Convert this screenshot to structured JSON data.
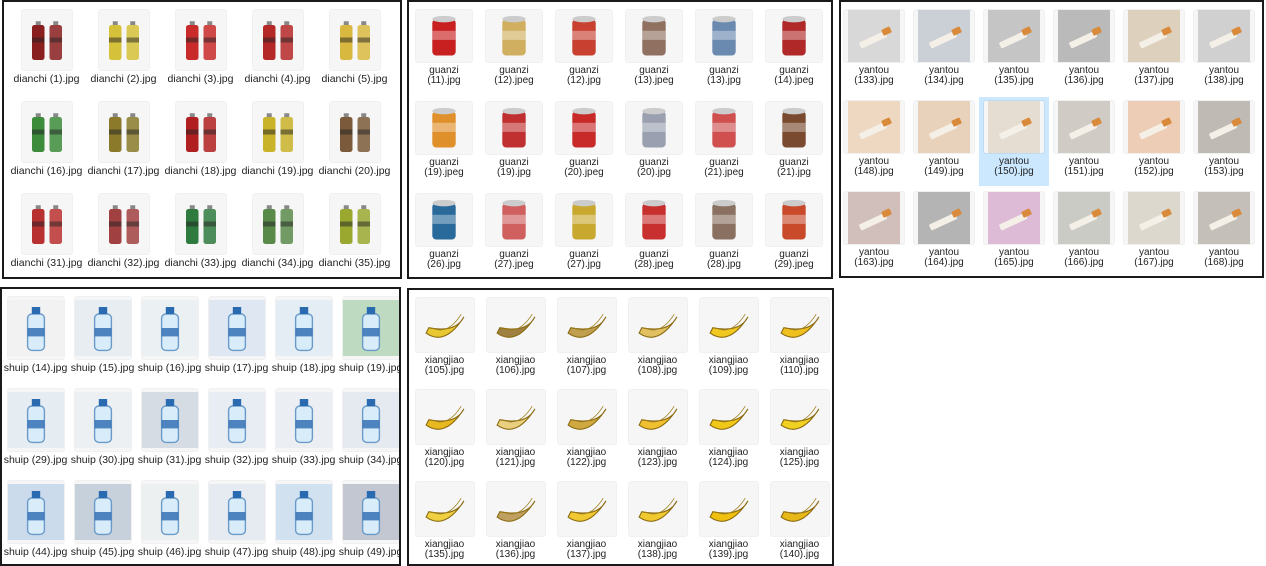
{
  "panels": [
    {
      "id": "dianchi",
      "items": [
        {
          "name": "dianchi (1).jpg",
          "c": "#8a1f1f",
          "icon": "battery-icon"
        },
        {
          "name": "dianchi (2).jpg",
          "c": "#d6c13a",
          "icon": "battery-icon"
        },
        {
          "name": "dianchi (3).jpg",
          "c": "#c92a2a",
          "icon": "battery-icon"
        },
        {
          "name": "dianchi (4).jpg",
          "c": "#b52828",
          "icon": "battery-icon"
        },
        {
          "name": "dianchi (5).jpg",
          "c": "#d9b840",
          "icon": "battery-icon"
        },
        {
          "name": "dianchi (16).jpg",
          "c": "#3c8c3c",
          "icon": "battery-icon"
        },
        {
          "name": "dianchi (17).jpg",
          "c": "#8a7a2a",
          "icon": "battery-icon"
        },
        {
          "name": "dianchi (18).jpg",
          "c": "#b02020",
          "icon": "battery-icon"
        },
        {
          "name": "dianchi (19).jpg",
          "c": "#c9b32a",
          "icon": "battery-icon"
        },
        {
          "name": "dianchi (20).jpg",
          "c": "#7a5a3a",
          "icon": "battery-icon"
        },
        {
          "name": "dianchi (31).jpg",
          "c": "#b83030",
          "icon": "battery-icon"
        },
        {
          "name": "dianchi (32).jpg",
          "c": "#a04040",
          "icon": "battery-icon"
        },
        {
          "name": "dianchi (33).jpg",
          "c": "#2f7a3f",
          "icon": "battery-icon"
        },
        {
          "name": "dianchi (34).jpg",
          "c": "#5a8a4a",
          "icon": "battery-icon"
        },
        {
          "name": "dianchi (35).jpg",
          "c": "#9aa830",
          "icon": "battery-icon"
        }
      ]
    },
    {
      "id": "guanzi",
      "items": [
        {
          "name": "guanzi (11).jpg",
          "c": "#c82020",
          "icon": "can-icon"
        },
        {
          "name": "guanzi (12).jpeg",
          "c": "#d0b060",
          "icon": "can-icon"
        },
        {
          "name": "guanzi (12).jpg",
          "c": "#c84030",
          "icon": "can-icon"
        },
        {
          "name": "guanzi (13).jpeg",
          "c": "#907060",
          "icon": "can-icon"
        },
        {
          "name": "guanzi (13).jpg",
          "c": "#6a8ab0",
          "icon": "can-icon"
        },
        {
          "name": "guanzi (14).jpeg",
          "c": "#b02828",
          "icon": "can-icon"
        },
        {
          "name": "guanzi (19).jpeg",
          "c": "#e0902a",
          "icon": "can-icon"
        },
        {
          "name": "guanzi (19).jpg",
          "c": "#c03030",
          "icon": "can-icon"
        },
        {
          "name": "guanzi (20).jpeg",
          "c": "#c82a2a",
          "icon": "can-icon"
        },
        {
          "name": "guanzi (20).jpg",
          "c": "#9aa0b0",
          "icon": "can-icon"
        },
        {
          "name": "guanzi (21).jpeg",
          "c": "#d05050",
          "icon": "can-icon"
        },
        {
          "name": "guanzi (21).jpg",
          "c": "#7a4a30",
          "icon": "can-icon"
        },
        {
          "name": "guanzi (26).jpg",
          "c": "#2a6a9a",
          "icon": "can-icon"
        },
        {
          "name": "guanzi (27).jpeg",
          "c": "#d06060",
          "icon": "can-icon"
        },
        {
          "name": "guanzi (27).jpg",
          "c": "#c9a830",
          "icon": "can-icon"
        },
        {
          "name": "guanzi (28).jpeg",
          "c": "#c83030",
          "icon": "can-icon"
        },
        {
          "name": "guanzi (28).jpg",
          "c": "#8a7060",
          "icon": "can-icon"
        },
        {
          "name": "guanzi (29).jpeg",
          "c": "#c84a2a",
          "icon": "can-icon"
        }
      ]
    },
    {
      "id": "yantou",
      "items": [
        {
          "name": "yantou (133).jpg",
          "c": "#a0a0a0",
          "icon": "cigarette-butt-icon"
        },
        {
          "name": "yantou (134).jpg",
          "c": "#7a8a9a",
          "icon": "cigarette-butt-icon"
        },
        {
          "name": "yantou (135).jpg",
          "c": "#6a6a6a",
          "icon": "cigarette-butt-icon"
        },
        {
          "name": "yantou (136).jpg",
          "c": "#4a4a4a",
          "icon": "cigarette-butt-icon"
        },
        {
          "name": "yantou (137).jpg",
          "c": "#b08a50",
          "icon": "cigarette-butt-icon"
        },
        {
          "name": "yantou (138).jpg",
          "c": "#8a8a8a",
          "icon": "cigarette-butt-icon"
        },
        {
          "name": "yantou (148).jpg",
          "c": "#e0a060",
          "icon": "cigarette-butt-icon"
        },
        {
          "name": "yantou (149).jpg",
          "c": "#d09050",
          "icon": "cigarette-butt-icon"
        },
        {
          "name": "yantou (150).jpg",
          "c": "#c8b090",
          "icon": "cigarette-butt-icon",
          "selected": true
        },
        {
          "name": "yantou (151).jpg",
          "c": "#8a7a6a",
          "icon": "cigarette-butt-icon"
        },
        {
          "name": "yantou (152).jpg",
          "c": "#e08040",
          "icon": "cigarette-butt-icon"
        },
        {
          "name": "yantou (153).jpg",
          "c": "#5a4a3a",
          "icon": "cigarette-butt-icon"
        },
        {
          "name": "yantou (163).jpg",
          "c": "#8a5a4a",
          "icon": "cigarette-butt-icon"
        },
        {
          "name": "yantou (164).jpg",
          "c": "#3a3a3a",
          "icon": "cigarette-butt-icon"
        },
        {
          "name": "yantou (165).jpg",
          "c": "#b04a9a",
          "icon": "cigarette-butt-icon"
        },
        {
          "name": "yantou (166).jpg",
          "c": "#7a7a6a",
          "icon": "cigarette-butt-icon"
        },
        {
          "name": "yantou (167).jpg",
          "c": "#b0a080",
          "icon": "cigarette-butt-icon"
        },
        {
          "name": "yantou (168).jpg",
          "c": "#6a5a4a",
          "icon": "cigarette-butt-icon"
        }
      ]
    },
    {
      "id": "shuip",
      "items": [
        {
          "name": "shuip (14).jpg",
          "c": "#e8e8ea",
          "icon": "water-bottle-icon"
        },
        {
          "name": "shuip (15).jpg",
          "c": "#c8d8e8",
          "icon": "water-bottle-icon"
        },
        {
          "name": "shuip (16).jpg",
          "c": "#d0e0ea",
          "icon": "water-bottle-icon"
        },
        {
          "name": "shuip (17).jpg",
          "c": "#a8c8e8",
          "icon": "water-bottle-icon"
        },
        {
          "name": "shuip (18).jpg",
          "c": "#b8d8f0",
          "icon": "water-bottle-icon"
        },
        {
          "name": "shuip (19).jpg",
          "c": "#3a9a4a",
          "icon": "water-bottle-icon"
        },
        {
          "name": "shuip (29).jpg",
          "c": "#c0d8e8",
          "icon": "water-bottle-icon"
        },
        {
          "name": "shuip (30).jpg",
          "c": "#d8e0ea",
          "icon": "water-bottle-icon"
        },
        {
          "name": "shuip (31).jpg",
          "c": "#8aa0b8",
          "icon": "water-bottle-icon"
        },
        {
          "name": "shuip (32).jpg",
          "c": "#c8d8ea",
          "icon": "water-bottle-icon"
        },
        {
          "name": "shuip (33).jpg",
          "c": "#d0dae8",
          "icon": "water-bottle-icon"
        },
        {
          "name": "shuip (34).jpg",
          "c": "#b8cce0",
          "icon": "water-bottle-icon"
        },
        {
          "name": "shuip (44).jpg",
          "c": "#6a9ad0",
          "icon": "water-bottle-icon"
        },
        {
          "name": "shuip (45).jpg",
          "c": "#5a7a9a",
          "icon": "water-bottle-icon"
        },
        {
          "name": "shuip (46).jpg",
          "c": "#d8e0e0",
          "icon": "water-bottle-icon"
        },
        {
          "name": "shuip (47).jpg",
          "c": "#c0d0e8",
          "icon": "water-bottle-icon"
        },
        {
          "name": "shuip (48).jpg",
          "c": "#7ab0e0",
          "icon": "water-bottle-icon"
        },
        {
          "name": "shuip (49).jpg",
          "c": "#4a5a7a",
          "icon": "water-bottle-icon"
        }
      ]
    },
    {
      "id": "xiangjiao",
      "items": [
        {
          "name": "xiangjiao (105).jpg",
          "c": "#e8c830",
          "icon": "banana-icon"
        },
        {
          "name": "xiangjiao (106).jpg",
          "c": "#a08040",
          "icon": "banana-icon"
        },
        {
          "name": "xiangjiao (107).jpg",
          "c": "#c0a050",
          "icon": "banana-icon"
        },
        {
          "name": "xiangjiao (108).jpg",
          "c": "#e0c060",
          "icon": "banana-icon"
        },
        {
          "name": "xiangjiao (109).jpg",
          "c": "#f0c820",
          "icon": "banana-icon"
        },
        {
          "name": "xiangjiao (110).jpg",
          "c": "#f0c020",
          "icon": "banana-icon"
        },
        {
          "name": "xiangjiao (120).jpg",
          "c": "#e8b820",
          "icon": "banana-icon"
        },
        {
          "name": "xiangjiao (121).jpg",
          "c": "#e8d080",
          "icon": "banana-icon"
        },
        {
          "name": "xiangjiao (122).jpg",
          "c": "#d0a840",
          "icon": "banana-icon"
        },
        {
          "name": "xiangjiao (123).jpg",
          "c": "#f0c030",
          "icon": "banana-icon"
        },
        {
          "name": "xiangjiao (124).jpg",
          "c": "#f0c818",
          "icon": "banana-icon"
        },
        {
          "name": "xiangjiao (125).jpg",
          "c": "#f0d020",
          "icon": "banana-icon"
        },
        {
          "name": "xiangjiao (135).jpg",
          "c": "#f0d040",
          "icon": "banana-icon"
        },
        {
          "name": "xiangjiao (136).jpg",
          "c": "#c0a060",
          "icon": "banana-icon"
        },
        {
          "name": "xiangjiao (137).jpg",
          "c": "#f0c830",
          "icon": "banana-icon"
        },
        {
          "name": "xiangjiao (138).jpg",
          "c": "#f0c830",
          "icon": "banana-icon"
        },
        {
          "name": "xiangjiao (139).jpg",
          "c": "#f0c010",
          "icon": "banana-icon"
        },
        {
          "name": "xiangjiao (140).jpg",
          "c": "#e8b818",
          "icon": "banana-icon"
        }
      ]
    }
  ]
}
